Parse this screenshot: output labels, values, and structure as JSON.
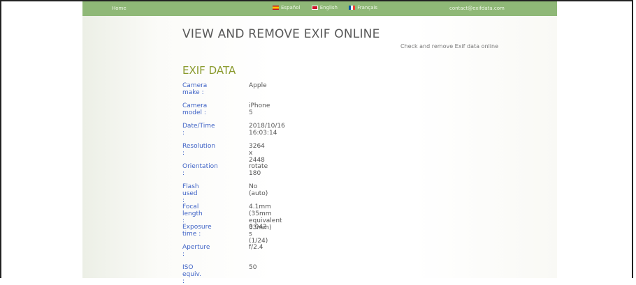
{
  "topbar": {
    "home_label": "Home",
    "languages": [
      {
        "label": "Español",
        "flag": "spain-flag-icon"
      },
      {
        "label": "English",
        "flag": "uk-flag-icon"
      },
      {
        "label": "Français",
        "flag": "france-flag-icon"
      }
    ],
    "contact_label": "contact@exifdata.com"
  },
  "header": {
    "title": "VIEW AND REMOVE EXIF ONLINE",
    "tagline": "Check and remove Exif data online"
  },
  "exif": {
    "heading": "EXIF DATA",
    "rows": [
      {
        "label": "Camera make :",
        "value": "Apple"
      },
      {
        "label": "Camera model :",
        "value": "iPhone 5"
      },
      {
        "label": "Date/Time :",
        "value": "2018/10/16 16:03:14"
      },
      {
        "label": "Resolution :",
        "value": "3264 x 2448"
      },
      {
        "label": "Orientation :",
        "value": "rotate 180"
      },
      {
        "label": "Flash used :",
        "value": "No (auto)"
      },
      {
        "label": "Focal length :",
        "value": "4.1mm (35mm equivalent 33mm)"
      },
      {
        "label": "Exposure time :",
        "value": "0.042 s (1/24)"
      },
      {
        "label": "Aperture :",
        "value": "f/2.4"
      },
      {
        "label": "ISO equiv. :",
        "value": "50"
      }
    ]
  },
  "colors": {
    "topbar_bg": "#8fb877",
    "label_blue": "#3f63c6",
    "heading_olive": "#8a9a2d",
    "title_gray": "#585858"
  }
}
